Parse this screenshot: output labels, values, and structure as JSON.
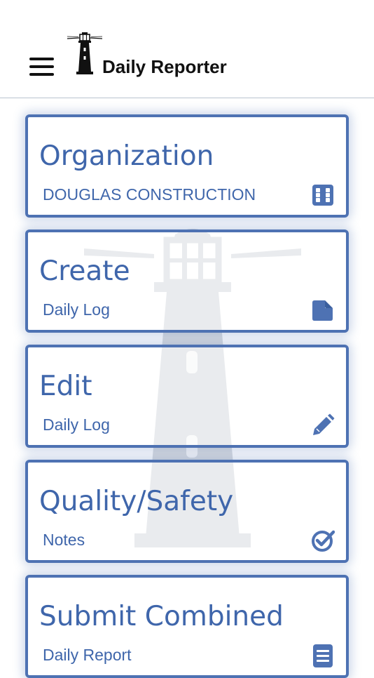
{
  "header": {
    "app_title": "Daily Reporter",
    "menu_icon": "hamburger-menu-icon",
    "logo_icon": "lighthouse-logo-icon"
  },
  "colors": {
    "accent": "#4e72b3",
    "text_accent": "#3f66ab",
    "header_text": "#111111",
    "watermark": "#d4d8dd"
  },
  "cards": [
    {
      "title": "Organization",
      "subtitle": "DOUGLAS CONSTRUCTION",
      "icon": "grid-icon"
    },
    {
      "title": "Create",
      "subtitle": "Daily Log",
      "icon": "document-icon"
    },
    {
      "title": "Edit",
      "subtitle": "Daily Log",
      "icon": "pencil-icon"
    },
    {
      "title": "Quality/Safety",
      "subtitle": "Notes",
      "icon": "check-circle-icon"
    },
    {
      "title": "Submit Combined",
      "subtitle": "Daily Report",
      "icon": "list-document-icon"
    }
  ]
}
